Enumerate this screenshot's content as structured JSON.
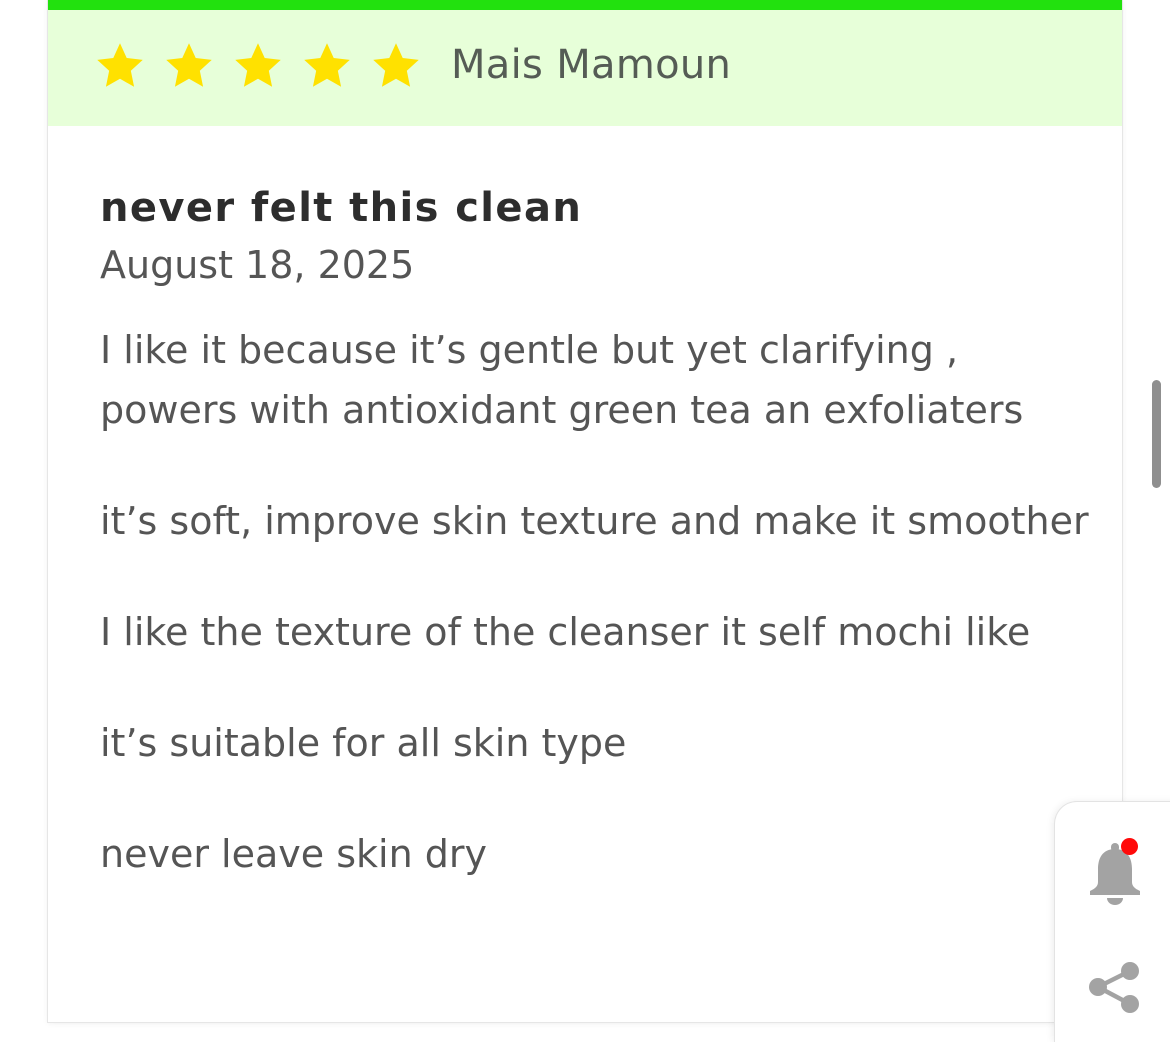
{
  "review": {
    "rating": 5,
    "rating_max": 5,
    "reviewer": "Mais Mamoun",
    "title": "never felt this clean",
    "date": "August 18, 2025",
    "paragraphs": [
      "I like it because it’s gentle but yet clarifying , powers with antioxidant green tea an exfoliaters",
      "it’s soft, improve skin texture and make it smoother",
      "I like the texture of the cleanser it self mochi like",
      "it’s suitable for all skin type",
      "never leave skin dry"
    ]
  },
  "icons": {
    "star": "star-icon",
    "bell": "bell-icon",
    "share": "share-icon"
  },
  "colors": {
    "accent_bar": "#22e10e",
    "header_bg": "#e7ffd9",
    "star_fill": "#ffe100",
    "notification_dot": "#ff0a0a",
    "icon_gray": "#a3a3a3"
  }
}
